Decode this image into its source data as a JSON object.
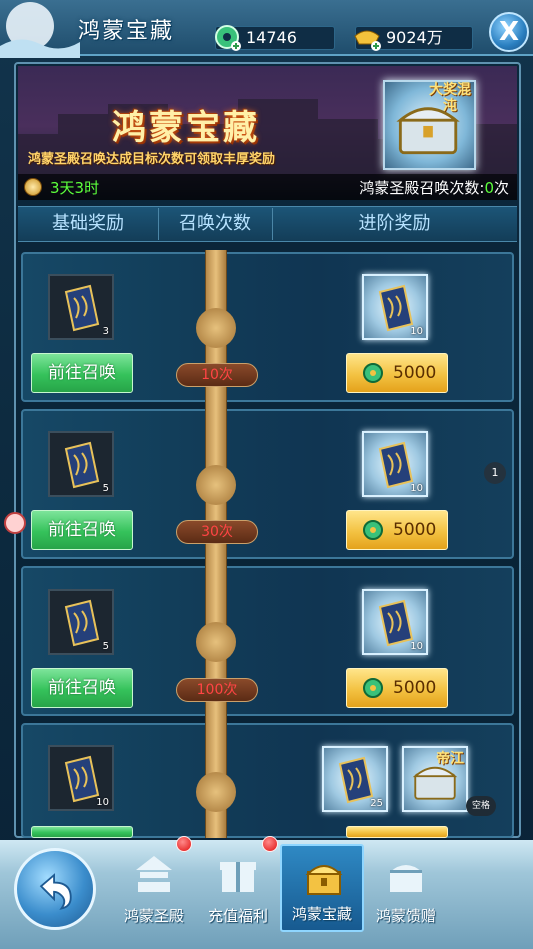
{
  "header": {
    "title": "鸿蒙宝藏",
    "jade_amount": "14746",
    "gold_amount": "9024万",
    "close_label": "X"
  },
  "banner": {
    "title": "鸿蒙宝藏",
    "subtitle": "鸿蒙圣殿召唤达成目标次数可领取丰厚奖励",
    "chest_tag": "大奖混沌",
    "timer": "3天3时",
    "count_label": "鸿蒙圣殿召唤次数:",
    "count_value": "0",
    "count_unit": "次"
  },
  "columns": {
    "basic": "基础奖励",
    "summons": "召唤次数",
    "advanced": "进阶奖励"
  },
  "rows": [
    {
      "basic_qty": "3",
      "button": "前往召唤",
      "target": "10次",
      "adv_qty": "10",
      "price": "5000"
    },
    {
      "basic_qty": "5",
      "button": "前往召唤",
      "target": "30次",
      "adv_qty": "10",
      "price": "5000"
    },
    {
      "basic_qty": "5",
      "button": "前往召唤",
      "target": "100次",
      "adv_qty": "10",
      "price": "5000"
    },
    {
      "basic_qty": "10",
      "adv_qty": "25",
      "chest_label": "帝江",
      "tag": "空格"
    }
  ],
  "side_badge": "1",
  "nav": [
    {
      "label": "鸿蒙圣殿",
      "active": false
    },
    {
      "label": "充值福利",
      "active": false
    },
    {
      "label": "鸿蒙宝藏",
      "active": true
    },
    {
      "label": "鸿蒙馈赠",
      "active": false
    }
  ],
  "colors": {
    "green_text": "#5cff3c",
    "red_text": "#ff4444",
    "accent": "#2f89c4"
  }
}
